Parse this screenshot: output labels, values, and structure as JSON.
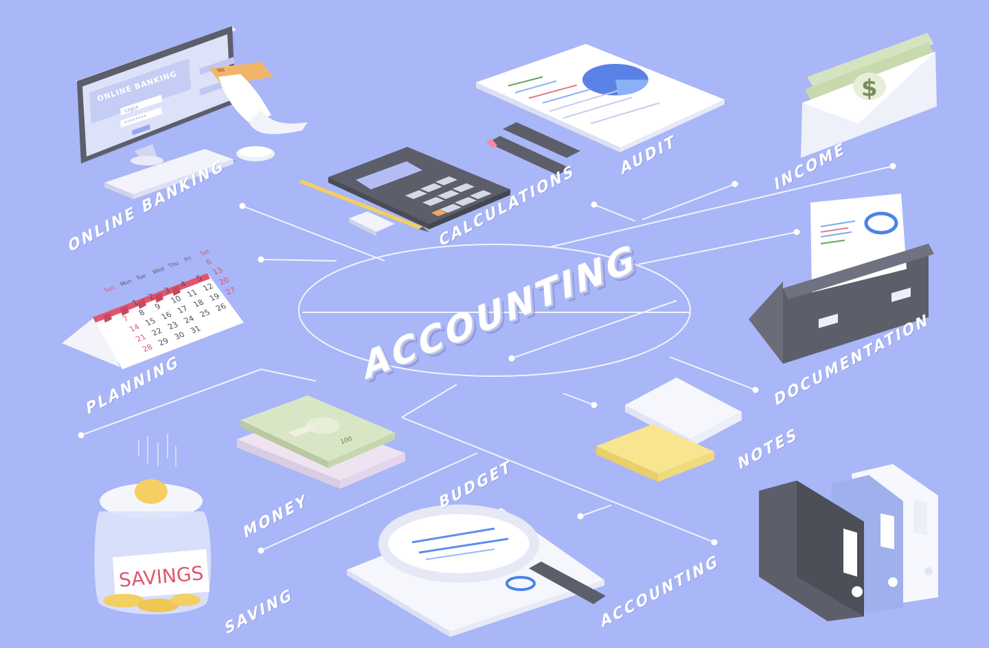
{
  "center_title": "ACCOUNTING",
  "branches": {
    "online_banking": "ONLINE BANKING",
    "calculations": "CALCULATIONS",
    "audit": "AUDIT",
    "income": "INCOME",
    "planning": "PLANNING",
    "documentation": "DOCUMENTATION",
    "money": "MONEY",
    "budget": "BUDGET",
    "notes": "NOTES",
    "saving": "SAVING",
    "accounting": "ACCOUNTING"
  },
  "monitor": {
    "screen_title": "ONLINE BANKING",
    "login_label": "Login",
    "password_mask": "********"
  },
  "calendar": {
    "weekdays": [
      "Sun",
      "Mon",
      "Tue",
      "Wed",
      "Thu",
      "Fri",
      "Sat"
    ],
    "rows": [
      [
        "",
        "",
        "",
        "",
        "",
        "",
        "6"
      ],
      [
        "",
        "1",
        "2",
        "3",
        "4",
        "5",
        "13"
      ],
      [
        "7",
        "8",
        "9",
        "10",
        "11",
        "12",
        "20"
      ],
      [
        "14",
        "15",
        "16",
        "17",
        "18",
        "19",
        "27"
      ],
      [
        "21",
        "22",
        "23",
        "24",
        "25",
        "26",
        ""
      ],
      [
        "28",
        "29",
        "30",
        "31",
        "",
        "",
        ""
      ]
    ]
  },
  "jar_label": "SAVINGS",
  "banknote": {
    "value": "100",
    "symbol": "$"
  },
  "colors": {
    "background": "#a9b6f7",
    "line": "#ffffff",
    "paper": "#f6f7fd",
    "dark": "#5d5f6b",
    "coin": "#f4cf63",
    "banknote": "#d9e6c6",
    "note_yellow": "#f8e58f",
    "calendar_red": "#e0566f"
  }
}
